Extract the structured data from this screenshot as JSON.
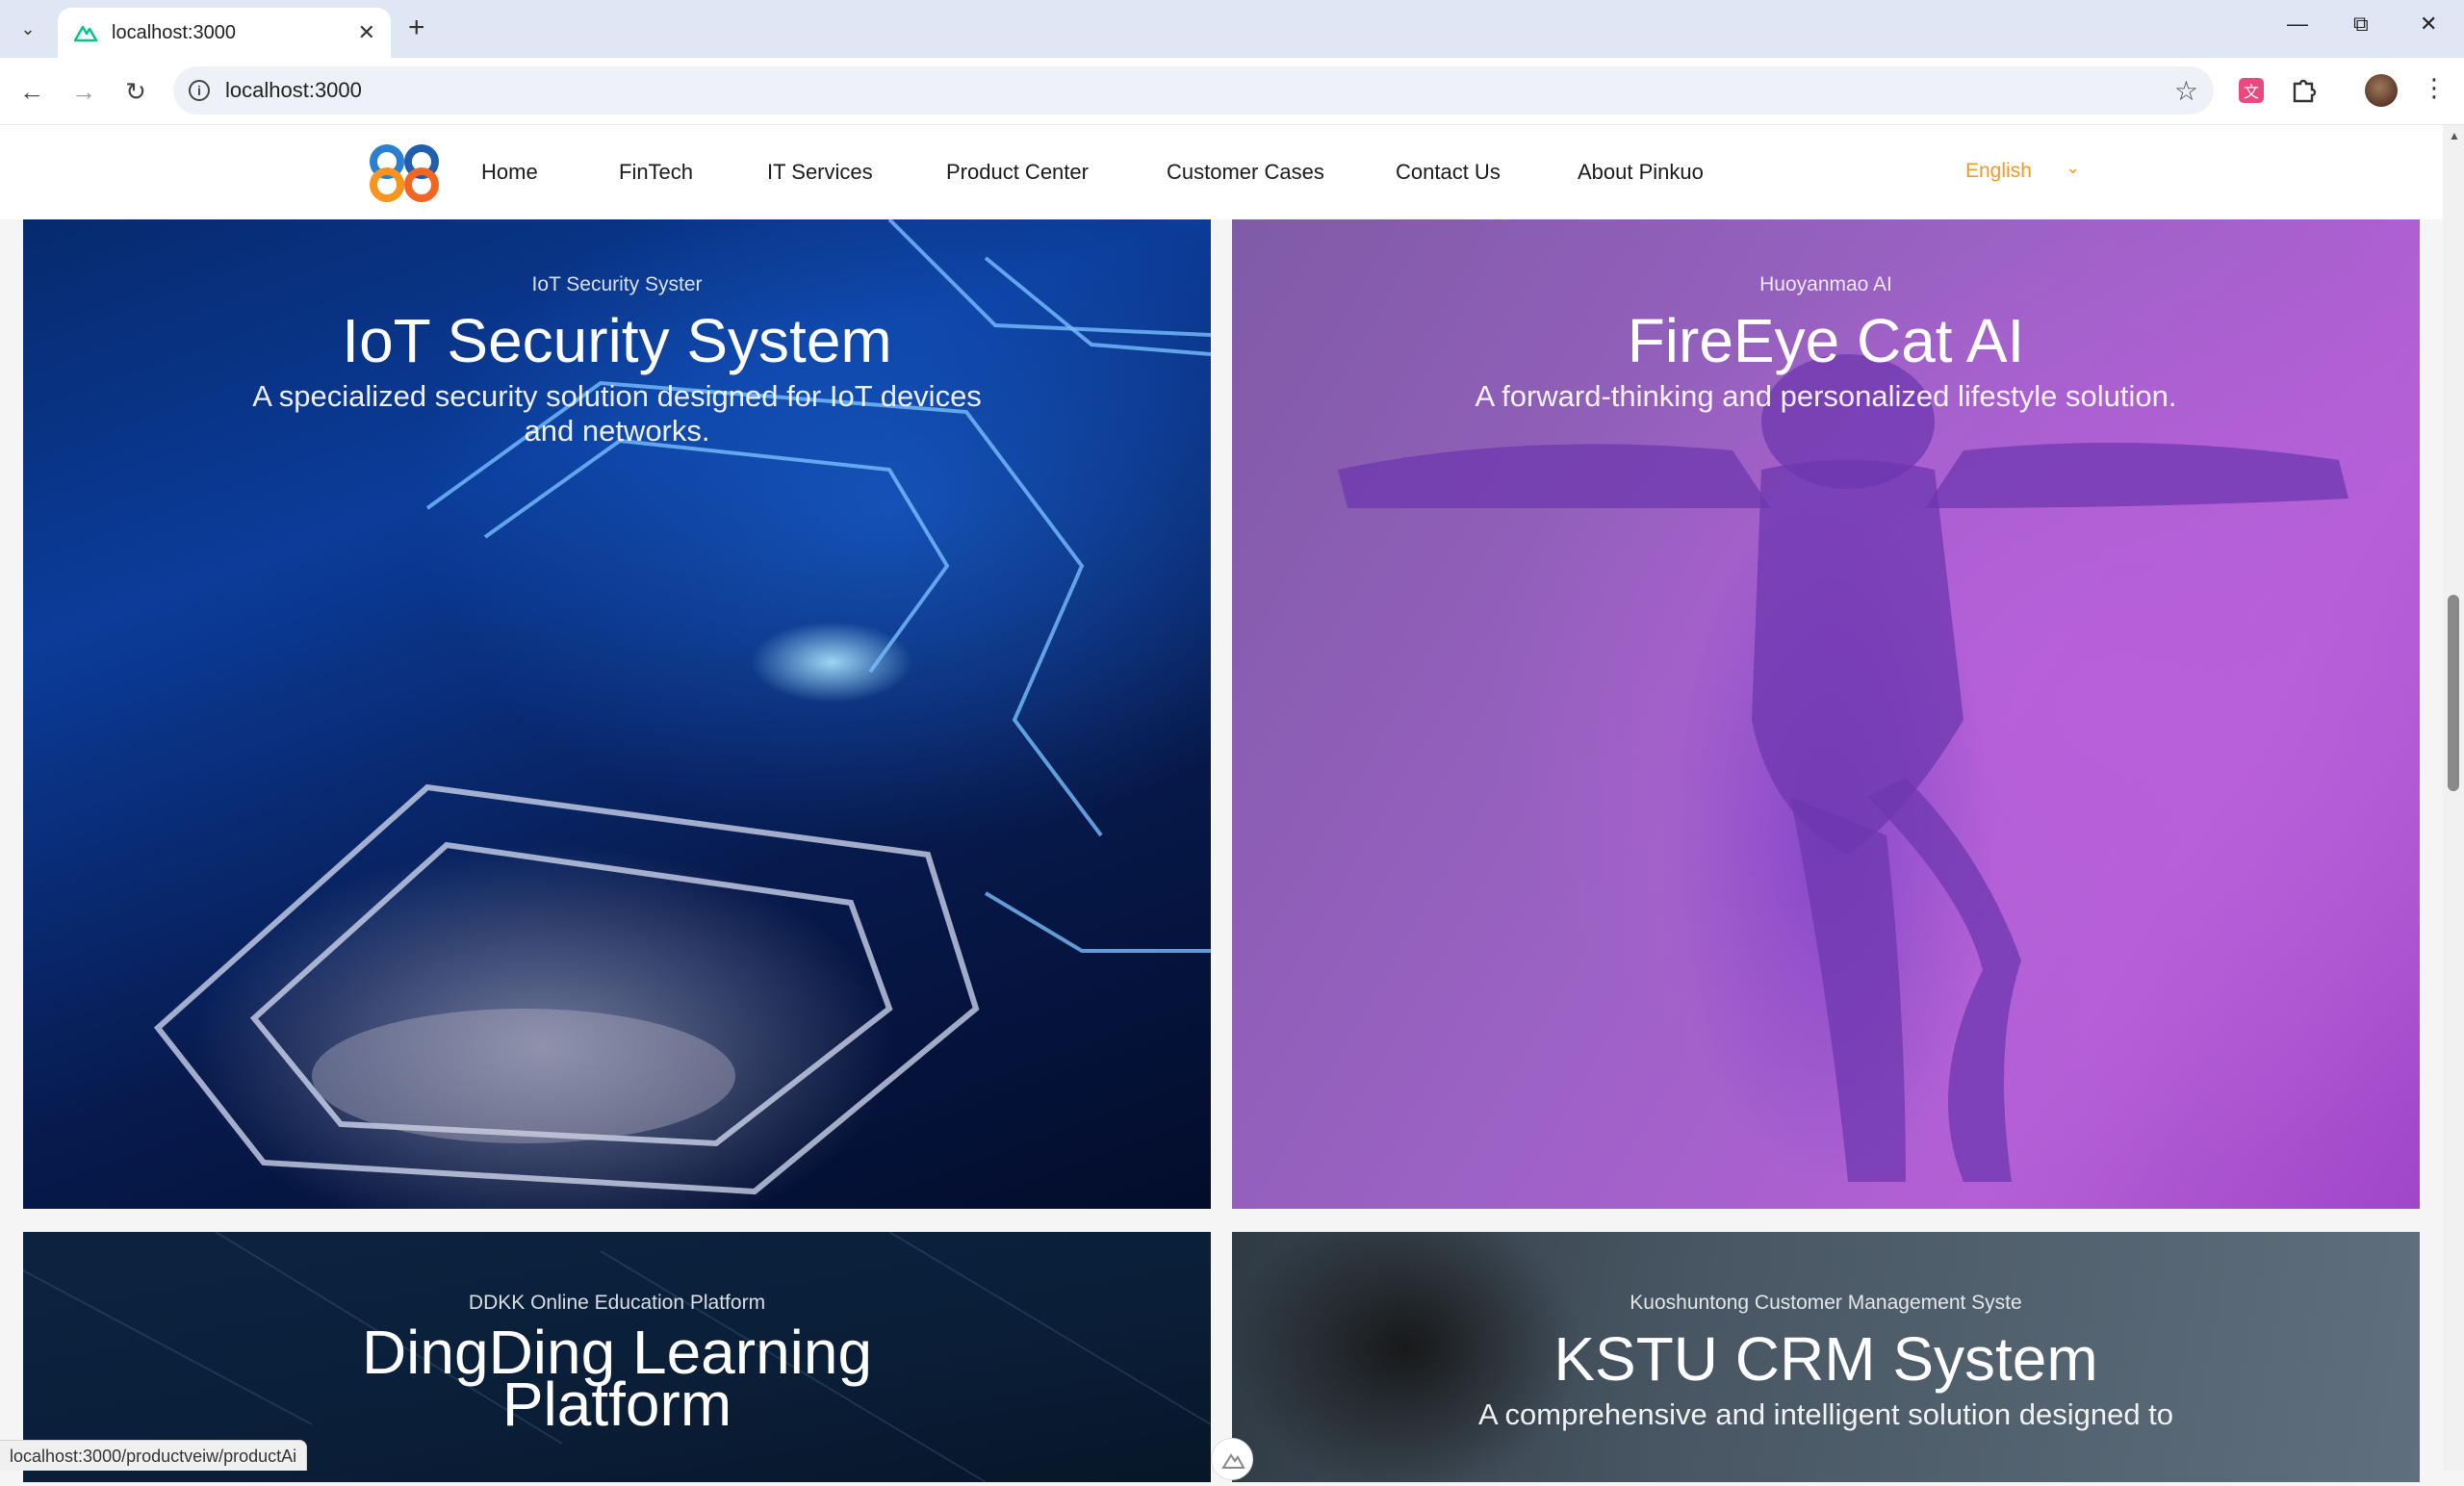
{
  "browser": {
    "tab_title": "localhost:3000",
    "url": "localhost:3000",
    "status_url": "localhost:3000/productveiw/productAi"
  },
  "nav": {
    "items": [
      "Home",
      "FinTech",
      "IT Services",
      "Product Center",
      "Customer Cases",
      "Contact Us",
      "About Pinkuo"
    ],
    "language": "English"
  },
  "cards": [
    {
      "subtitle": "IoT Security Syster",
      "title": "IoT Security System",
      "description": "A specialized security solution designed for IoT devices and networks."
    },
    {
      "subtitle": "Huoyanmao AI",
      "title": "FireEye Cat AI",
      "description": "A forward-thinking and personalized lifestyle solution."
    },
    {
      "subtitle": "DDKK Online Education Platform",
      "title": "DingDing Learning Platform",
      "description": ""
    },
    {
      "subtitle": "Kuoshuntong Customer Management Syste",
      "title": "KSTU CRM System",
      "description": "A comprehensive and intelligent solution designed to"
    }
  ],
  "colors": {
    "accent": "#f39a23"
  }
}
